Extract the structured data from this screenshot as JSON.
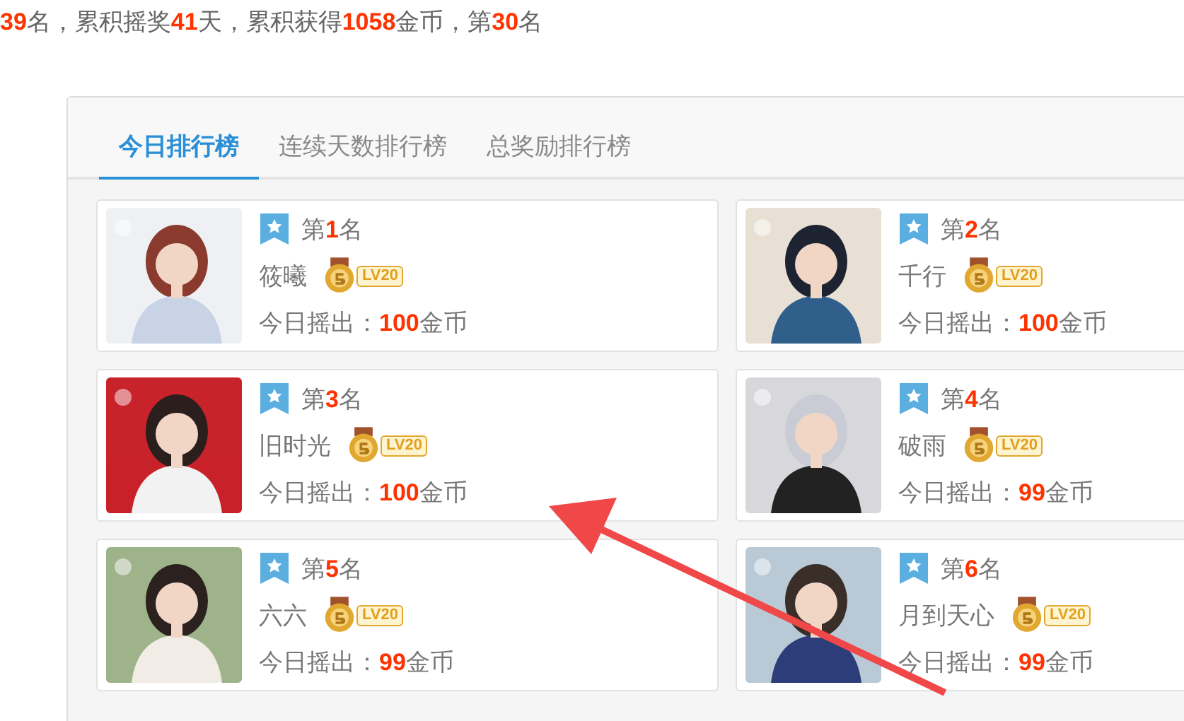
{
  "summary": "**39**名，累积摇奖**41**天，累积获得**1058**金币，第**30**名",
  "tabs": [
    {
      "label": "今日排行榜",
      "selected": true
    },
    {
      "label": "连续天数排行榜",
      "selected": false
    },
    {
      "label": "总奖励排行榜",
      "selected": false
    }
  ],
  "ranks": [
    {
      "rank": "第**1**名",
      "name": "筱曦",
      "level": "LV20",
      "today": "今日摇出：**100**金币"
    },
    {
      "rank": "第**2**名",
      "name": "千行",
      "level": "LV20",
      "today": "今日摇出：**100**金币"
    },
    {
      "rank": "第**3**名",
      "name": "旧时光",
      "level": "LV20",
      "today": "今日摇出：**100**金币"
    },
    {
      "rank": "第**4**名",
      "name": "破雨",
      "level": "LV20",
      "today": "今日摇出：**99**金币"
    },
    {
      "rank": "第**5**名",
      "name": "六六",
      "level": "LV20",
      "today": "今日摇出：**99**金币"
    },
    {
      "rank": "第**6**名",
      "name": "月到天心",
      "level": "LV20",
      "today": "今日摇出：**99**金币"
    }
  ]
}
